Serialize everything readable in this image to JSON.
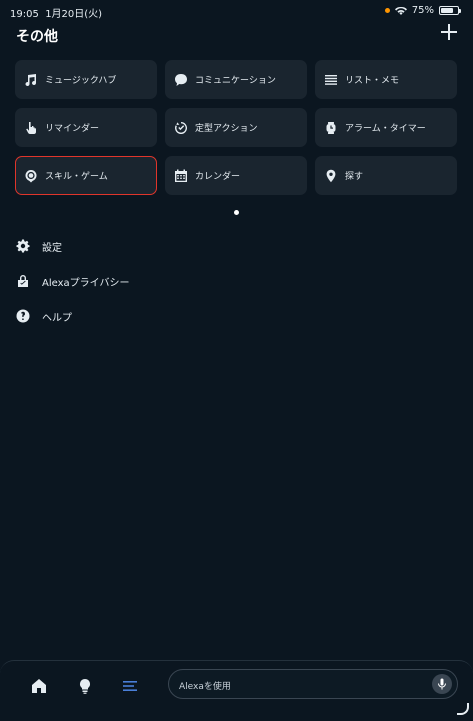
{
  "status_bar": {
    "time": "19:05",
    "date": "1月20日(火)",
    "battery": "75%",
    "battery_level": 0.75
  },
  "header": {
    "title": "その他"
  },
  "tiles": [
    {
      "label": "ミュージックハブ",
      "icon": "music-note-icon"
    },
    {
      "label": "コミュニケーション",
      "icon": "chat-bubble-icon"
    },
    {
      "label": "リスト・メモ",
      "icon": "list-icon"
    },
    {
      "label": "リマインダー",
      "icon": "hand-pointer-icon"
    },
    {
      "label": "定型アクション",
      "icon": "routine-check-icon"
    },
    {
      "label": "アラーム・タイマー",
      "icon": "alarm-clock-icon"
    },
    {
      "label": "スキル・ゲーム",
      "icon": "skills-icon",
      "selected": true
    },
    {
      "label": "カレンダー",
      "icon": "calendar-icon"
    },
    {
      "label": "探す",
      "icon": "location-pin-icon"
    }
  ],
  "menu": [
    {
      "label": "設定",
      "icon": "gear-icon"
    },
    {
      "label": "Alexaプライバシー",
      "icon": "privacy-lock-icon"
    },
    {
      "label": "ヘルプ",
      "icon": "help-icon"
    }
  ],
  "bottom_bar": {
    "search_placeholder": "Alexaを使用",
    "active_tab": "more",
    "accent_color": "#4a7fd8"
  }
}
